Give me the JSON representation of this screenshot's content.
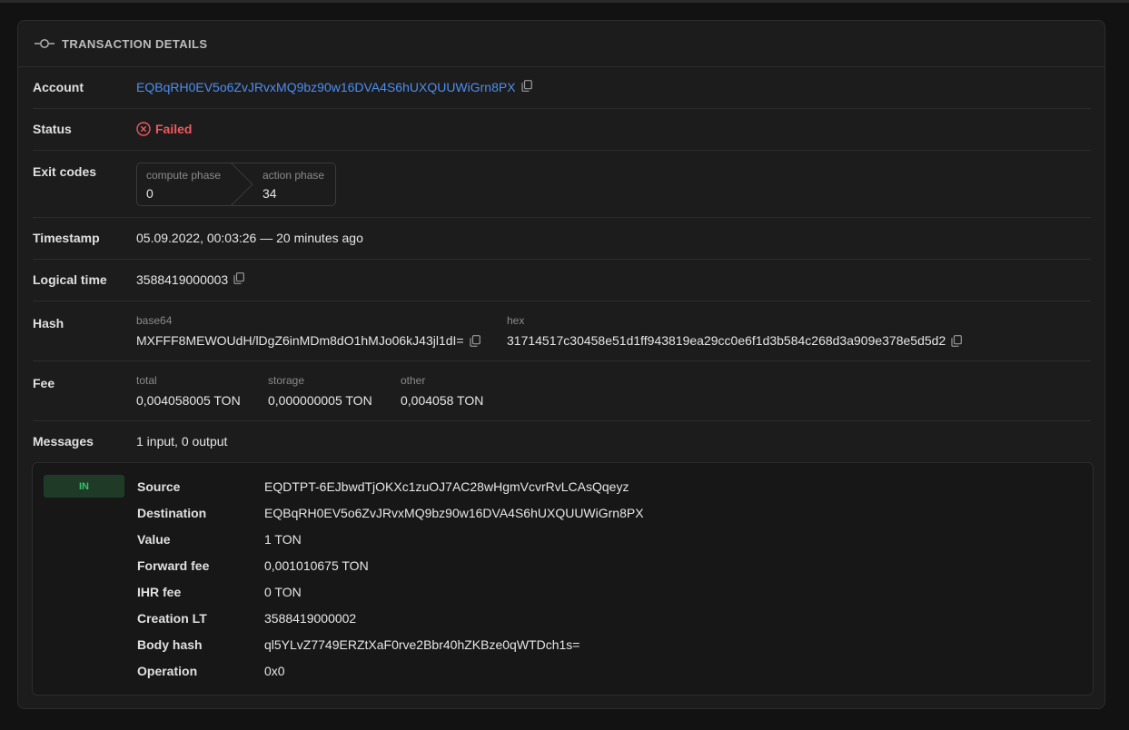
{
  "header": {
    "title": "TRANSACTION DETAILS",
    "icon": "commit-icon"
  },
  "account": {
    "label": "Account",
    "value": "EQBqRH0EV5o6ZvJRvxMQ9bz90w16DVA4S6hUXQUUWiGrn8PX"
  },
  "status": {
    "label": "Status",
    "value": "Failed",
    "color": "#f0595c"
  },
  "exit_codes": {
    "label": "Exit codes",
    "compute_label": "compute phase",
    "compute_value": "0",
    "action_label": "action phase",
    "action_value": "34"
  },
  "timestamp": {
    "label": "Timestamp",
    "value": "05.09.2022, 00:03:26 — 20 minutes ago"
  },
  "logical_time": {
    "label": "Logical time",
    "value": "3588419000003"
  },
  "hash": {
    "label": "Hash",
    "base64_label": "base64",
    "base64_value": "MXFFF8MEWOUdH/lDgZ6inMDm8dO1hMJo06kJ43jl1dI=",
    "hex_label": "hex",
    "hex_value": "31714517c30458e51d1ff943819ea29cc0e6f1d3b584c268d3a909e378e5d5d2"
  },
  "fee": {
    "label": "Fee",
    "total_label": "total",
    "total_value": "0,004058005 TON",
    "storage_label": "storage",
    "storage_value": "0,000000005 TON",
    "other_label": "other",
    "other_value": "0,004058 TON"
  },
  "messages": {
    "label": "Messages",
    "value": "1 input, 0 output"
  },
  "message": {
    "badge": "IN",
    "source_label": "Source",
    "source_value": "EQDTPT-6EJbwdTjOKXc1zuOJ7AC28wHgmVcvrRvLCAsQqeyz",
    "destination_label": "Destination",
    "destination_value": "EQBqRH0EV5o6ZvJRvxMQ9bz90w16DVA4S6hUXQUUWiGrn8PX",
    "value_label": "Value",
    "value_value": "1 TON",
    "forward_fee_label": "Forward fee",
    "forward_fee_value": "0,001010675 TON",
    "ihr_fee_label": "IHR fee",
    "ihr_fee_value": "0 TON",
    "creation_lt_label": "Creation LT",
    "creation_lt_value": "3588419000002",
    "body_hash_label": "Body hash",
    "body_hash_value": "ql5YLvZ7749ERZtXaF0rve2Bbr40hZKBze0qWTDch1s=",
    "operation_label": "Operation",
    "operation_value": "0x0"
  }
}
